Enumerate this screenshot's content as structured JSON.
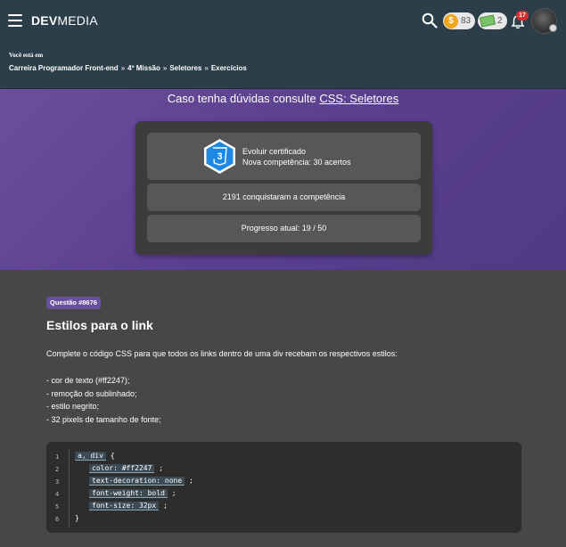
{
  "header": {
    "logo_bold": "DEV",
    "logo_light": "MEDIA",
    "coins": "83",
    "cash": "2",
    "notifications": "17"
  },
  "breadcrumb": {
    "label": "Você está em",
    "items": [
      "Carreira Programador Front-end",
      "4º Missão",
      "Seletores",
      "Exercícios"
    ]
  },
  "help": {
    "text": "Caso tenha dúvidas consulte",
    "link": "CSS: Seletores"
  },
  "card": {
    "badge_text": "3",
    "cert_line1": "Evoluir certificado",
    "cert_line2": "Nova competência: 30 acertos",
    "conquered": "2191 conquistaram a competência",
    "progress": "Progresso atual: 19 / 50"
  },
  "question": {
    "tag": "Questão #8676",
    "title": "Estilos para o link",
    "description": "Complete o código CSS para que todos os links dentro de uma div recebam os respectivos estilos:",
    "requirements": [
      "- cor de texto (#ff2247);",
      "- remoção do sublinhado;",
      "- estilo negrito;",
      "- 32 pixels de tamanho de fonte;"
    ]
  },
  "code": {
    "line_numbers": [
      "1",
      "2",
      "3",
      "4",
      "5",
      "6"
    ],
    "blanks": [
      "a, div",
      "color: #ff2247",
      "text-decoration: none",
      "font-weight: bold",
      "font-size: 32px"
    ],
    "open_brace": "{",
    "close_brace": "}",
    "semicolon": ";"
  },
  "colors": {
    "header_bg": "#2c3e4a",
    "band": "#5b3f8f",
    "body_bg": "#474747",
    "tag": "#6a4f9c",
    "coin": "#f0a51e",
    "badge": "#d32f2f",
    "css_badge": "#1e88e5"
  }
}
